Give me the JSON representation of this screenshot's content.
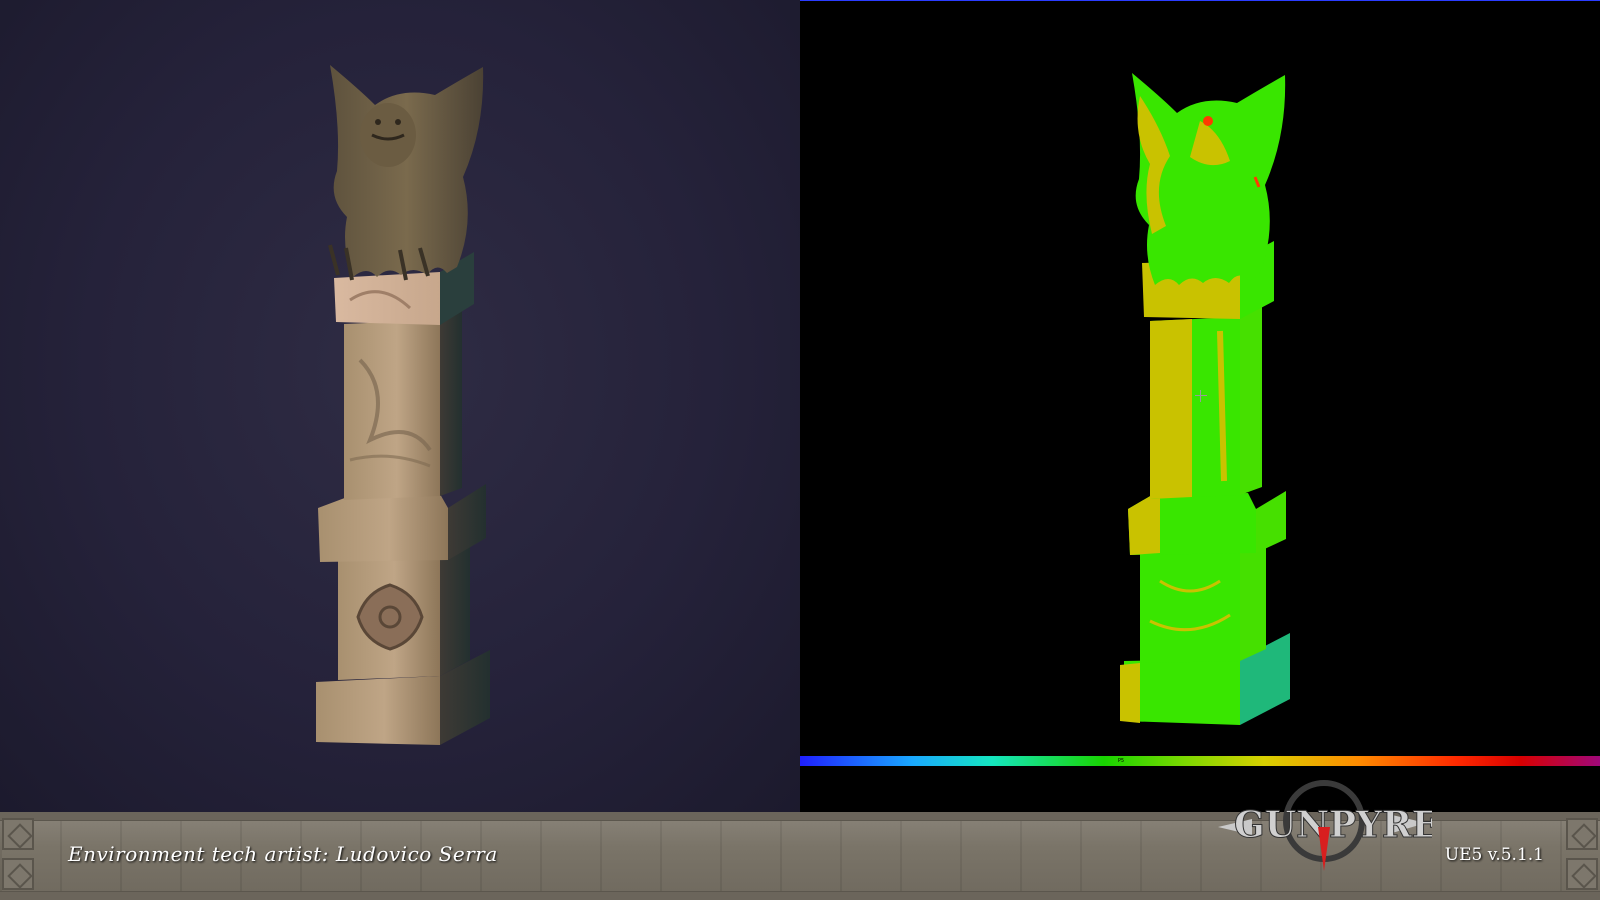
{
  "footer": {
    "credit": "Environment tech artist: Ludovico Serra",
    "version": "UE5 v.5.1.1",
    "logo_text": "GUNPYRE"
  },
  "spectrum_bar": {
    "marker": "P5"
  },
  "colors": {
    "left_background": "#25223a",
    "right_background": "#000000",
    "stone_color": "#b59a7c",
    "heatmap_green": "#39e600",
    "heatmap_yellow": "#d6c000",
    "logo_red": "#d81f1f",
    "logo_silver": "#c9c9c9"
  },
  "icons": {
    "crosshair": "crosshair-icon"
  }
}
